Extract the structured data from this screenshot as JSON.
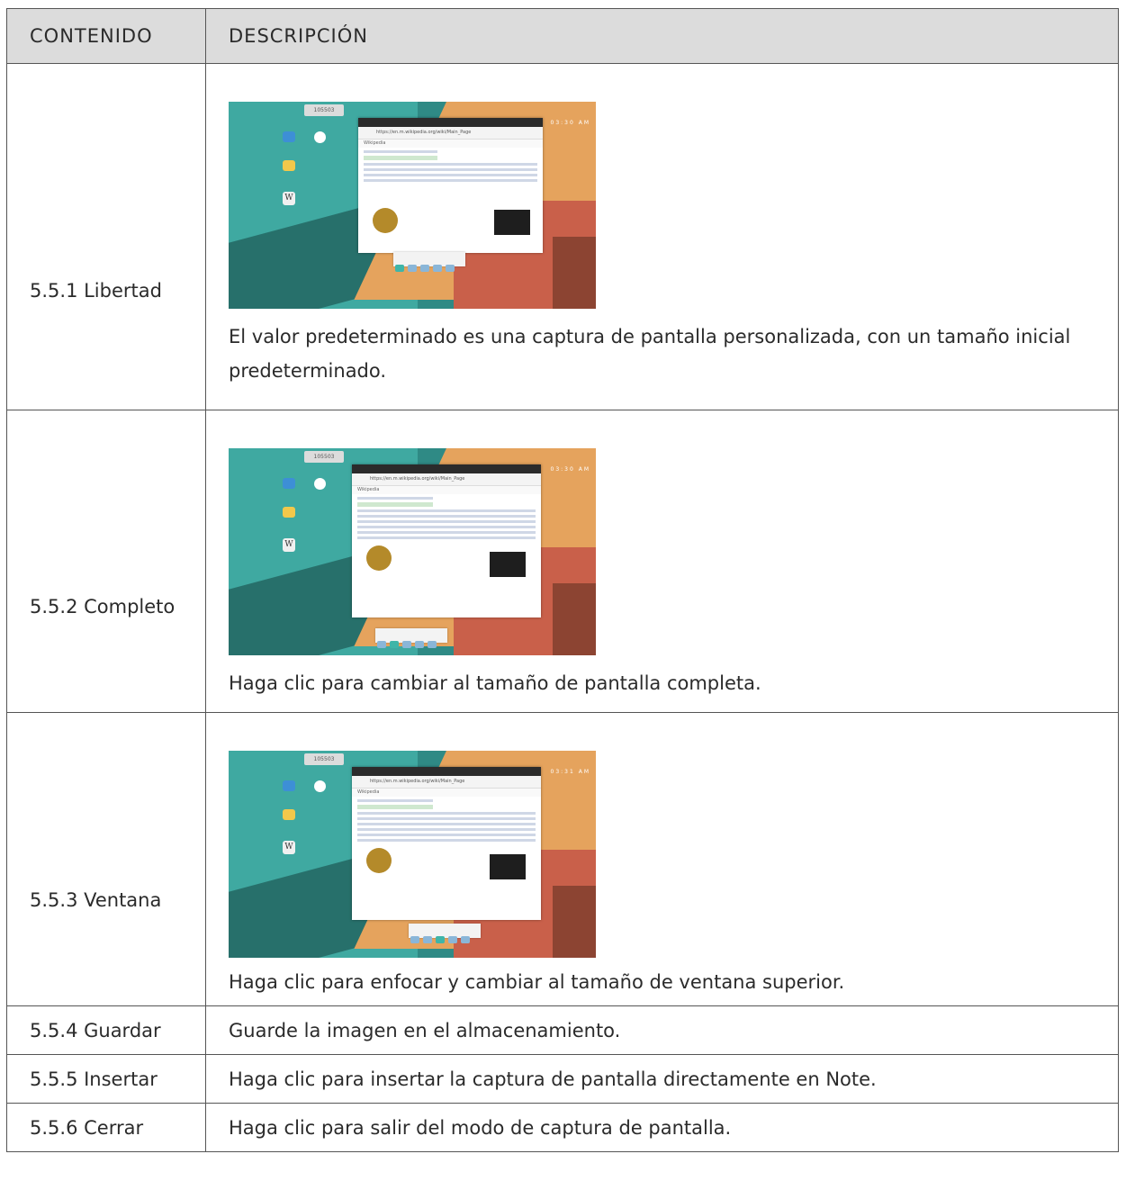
{
  "header": {
    "col1": "CONTENIDO",
    "col2": "DESCRIPCIÓN"
  },
  "rows": [
    {
      "label": "5.5.1 Libertad",
      "desc": "El valor predeterminado es una captura de pantalla personalizada, con un tamaño inicial predeterminado."
    },
    {
      "label": "5.5.2 Completo",
      "desc": "Haga clic para cambiar al tamaño de pantalla completa."
    },
    {
      "label": "5.5.3 Ventana",
      "desc": "Haga clic para enfocar y cambiar al tamaño de ventana superior."
    },
    {
      "label": "5.5.4 Guardar",
      "desc": "Guarde la imagen en el almacenamiento."
    },
    {
      "label": "5.5.5 Insertar",
      "desc": "Haga clic para insertar la captura de pantalla directamente en Note."
    },
    {
      "label": "5.5.6 Cerrar",
      "desc": "Haga clic para salir del modo de captura de pantalla."
    }
  ],
  "screenshot": {
    "pill_text": "105503",
    "status_text_1": "03:30 AM",
    "status_text_2": "03:30 AM",
    "status_text_3": "03:31 AM",
    "url_text": "https://en.m.wikipedia.org/wiki/Main_Page",
    "wiki_text": "Wikipedia"
  },
  "colors": {
    "header_bg": "#dcdcdc",
    "border": "#555555"
  }
}
